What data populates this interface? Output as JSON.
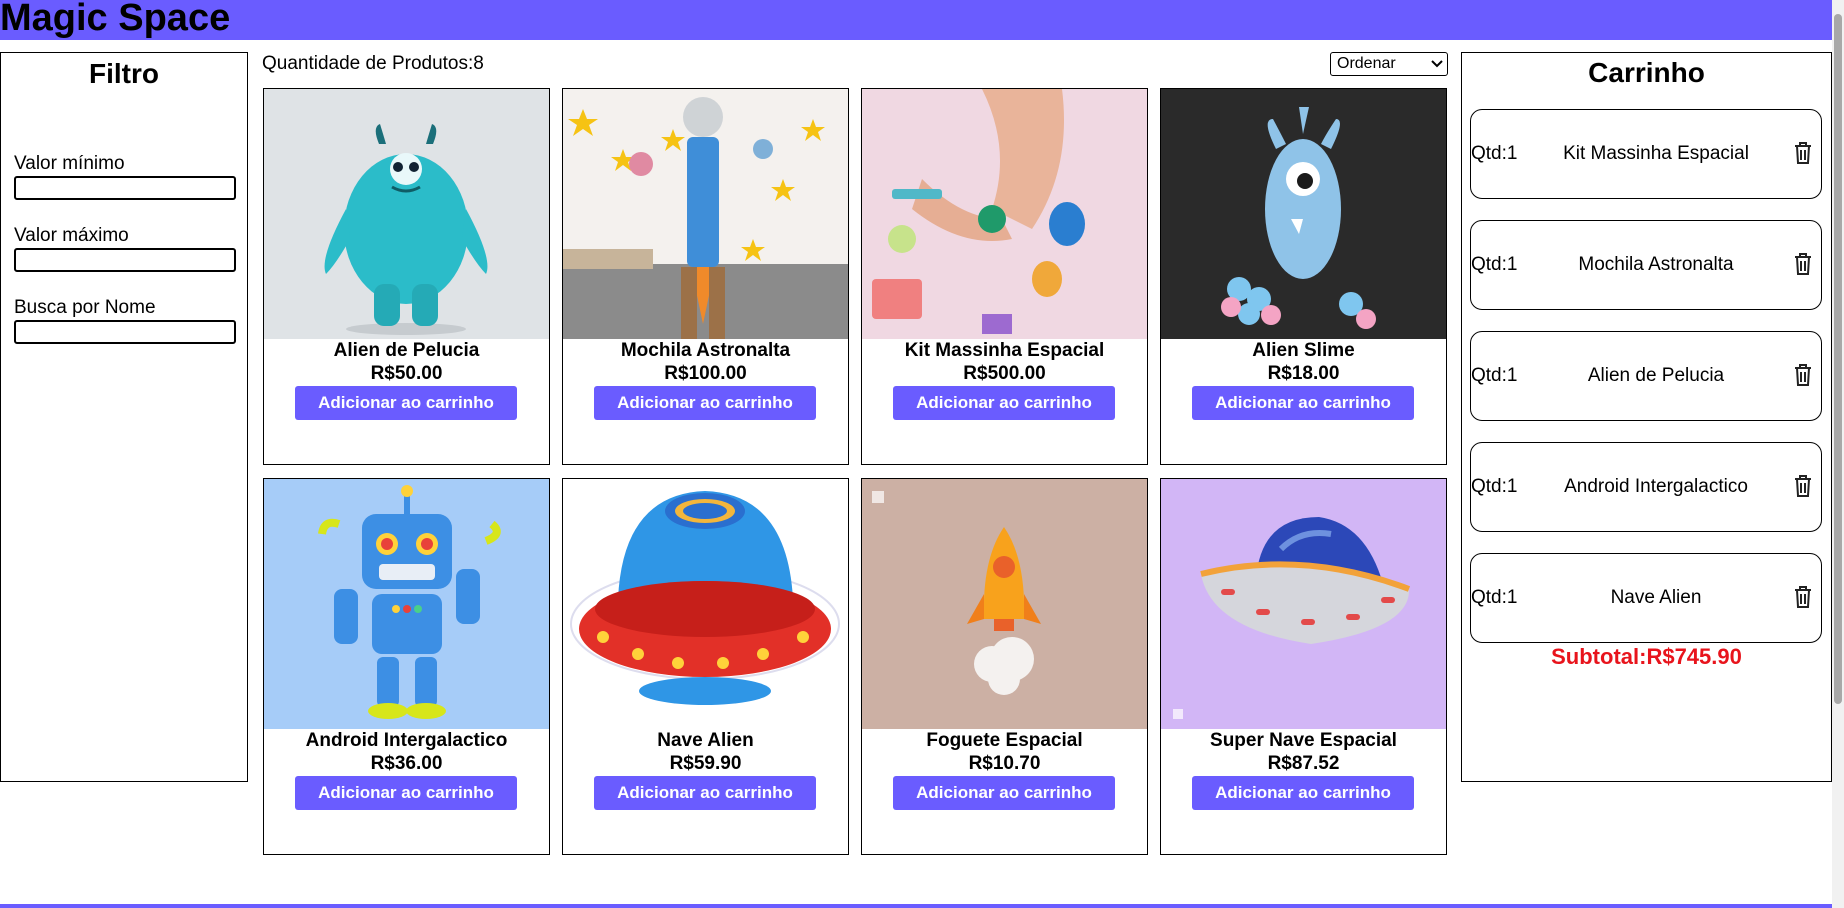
{
  "header": {
    "brand": "Magic Space"
  },
  "filter": {
    "title": "Filtro",
    "min_label": "Valor mínimo",
    "max_label": "Valor máximo",
    "name_label": "Busca por Nome"
  },
  "main": {
    "quantity_text": "Quantidade de Produtos:8",
    "sort": {
      "selected": "Ordenar"
    },
    "add_label": "Adicionar ao carrinho",
    "products": [
      {
        "name": "Alien de Pelucia",
        "price": "R$50.00",
        "image_icon": "blue-fluffy-monster-plush"
      },
      {
        "name": "Mochila Astronalta",
        "price": "R$100.00",
        "image_icon": "kid-with-rocket-backpack"
      },
      {
        "name": "Kit Massinha Espacial",
        "price": "R$500.00",
        "image_icon": "hands-with-play-dough"
      },
      {
        "name": "Alien Slime",
        "price": "R$18.00",
        "image_icon": "blue-one-eyed-monster"
      },
      {
        "name": "Android Intergalactico",
        "price": "R$36.00",
        "image_icon": "blue-toy-robot"
      },
      {
        "name": "Nave Alien",
        "price": "R$59.90",
        "image_icon": "ufo-sticker"
      },
      {
        "name": "Foguete Espacial",
        "price": "R$10.70",
        "image_icon": "orange-rocket"
      },
      {
        "name": "Super Nave Espacial",
        "price": "R$87.52",
        "image_icon": "flying-saucer"
      }
    ]
  },
  "cart": {
    "title": "Carrinho",
    "items": [
      {
        "qty": "Qtd:1",
        "name": "Kit Massinha Espacial"
      },
      {
        "qty": "Qtd:1",
        "name": "Mochila Astronalta"
      },
      {
        "qty": "Qtd:1",
        "name": "Alien de Pelucia"
      },
      {
        "qty": "Qtd:1",
        "name": "Android Intergalactico"
      },
      {
        "qty": "Qtd:1",
        "name": "Nave Alien"
      }
    ],
    "subtotal": "Subtotal:R$745.90"
  },
  "colors": {
    "accent": "#6a5cff",
    "subtotal": "#e8141c"
  }
}
